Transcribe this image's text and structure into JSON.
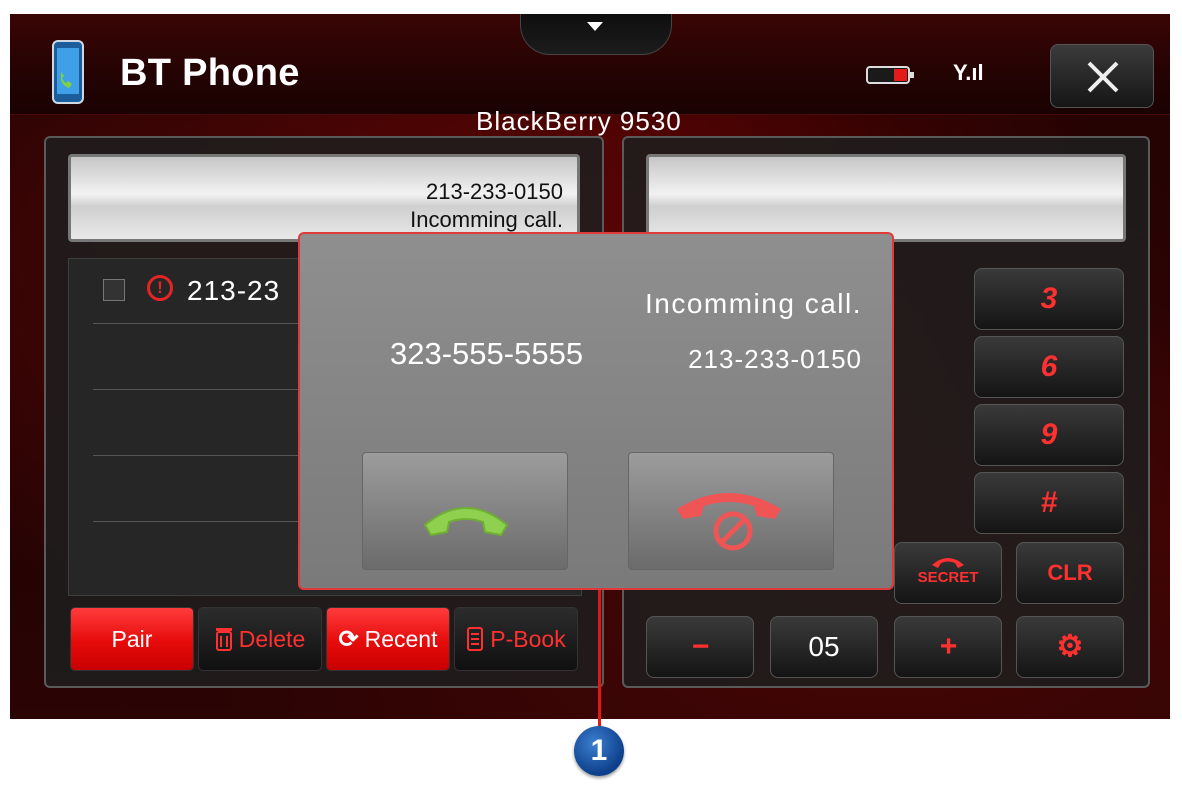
{
  "header": {
    "title": "BT Phone",
    "device_name": "BlackBerry 9530",
    "app_icon": "phone-app-icon",
    "battery_icon": "battery-icon",
    "signal_icon": "signal-icon",
    "signal_text": "Y.ıl",
    "close_label": "✕"
  },
  "left_panel": {
    "display": {
      "number": "213-233-0150",
      "status": "Incomming call."
    },
    "list": [
      {
        "number": "213-23",
        "icon": "missed-call-alert-icon",
        "checked": false
      }
    ],
    "buttons": [
      {
        "label": "Pair",
        "icon": "",
        "active": true
      },
      {
        "label": "Delete",
        "icon": "trash-icon",
        "active": false
      },
      {
        "label": "Recent",
        "icon": "refresh-icon",
        "active": true
      },
      {
        "label": "P-Book",
        "icon": "book-icon",
        "active": false
      }
    ]
  },
  "right_panel": {
    "keypad": {
      "visible_keys": [
        "3",
        "6",
        "9",
        "#"
      ],
      "secret_label": "SECRET",
      "clear_label": "CLR"
    },
    "volume": {
      "minus_label": "−",
      "value": "05",
      "plus_label": "+",
      "settings_icon": "gear-icon"
    }
  },
  "incoming_call_dialog": {
    "status": "Incomming call.",
    "caller": "323-555-5555",
    "number": "213-233-0150",
    "accept_icon": "accept-call-icon",
    "reject_icon": "reject-call-icon"
  },
  "callout": {
    "label": "1"
  },
  "colors": {
    "accent_red": "#e60b0b",
    "key_text_red": "#ff3030",
    "accept_green": "#8fd14f",
    "reject_red": "#f05555",
    "callout_blue": "#1a4f9c"
  }
}
